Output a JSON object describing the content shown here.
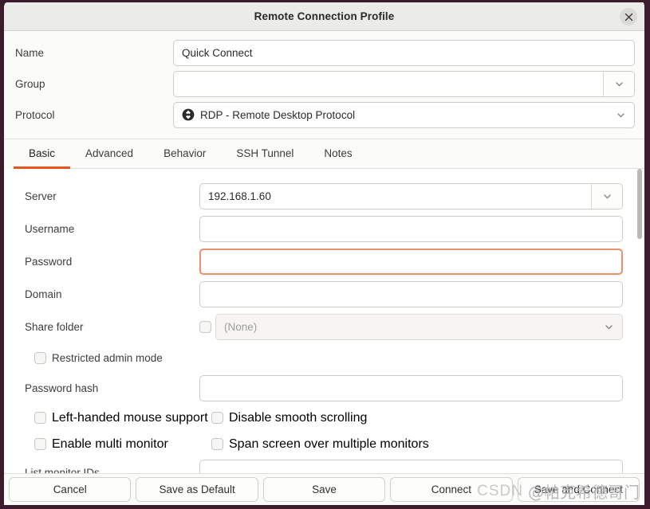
{
  "window": {
    "title": "Remote Connection Profile",
    "close_icon": "close-icon"
  },
  "top_form": {
    "name": {
      "label": "Name",
      "value": "Quick Connect",
      "placeholder": ""
    },
    "group": {
      "label": "Group",
      "value": "",
      "placeholder": ""
    },
    "protocol": {
      "label": "Protocol",
      "value": "RDP - Remote Desktop Protocol",
      "icon": "rdp-protocol-icon"
    }
  },
  "tabs": {
    "active": "Basic",
    "items": [
      {
        "label": "Basic"
      },
      {
        "label": "Advanced"
      },
      {
        "label": "Behavior"
      },
      {
        "label": "SSH Tunnel"
      },
      {
        "label": "Notes"
      }
    ]
  },
  "basic": {
    "server": {
      "label": "Server",
      "value": "192.168.1.60",
      "placeholder": ""
    },
    "username": {
      "label": "Username",
      "value": "",
      "placeholder": ""
    },
    "password": {
      "label": "Password",
      "value": "",
      "placeholder": "",
      "focused": true
    },
    "domain": {
      "label": "Domain",
      "value": "",
      "placeholder": ""
    },
    "share_folder": {
      "label": "Share folder",
      "value": "(None)",
      "checked": false,
      "enabled": false
    },
    "restricted_admin_mode": {
      "label": "Restricted admin mode",
      "checked": false
    },
    "password_hash": {
      "label": "Password hash",
      "value": "",
      "placeholder": ""
    },
    "left_handed_mouse": {
      "label": "Left-handed mouse support",
      "checked": false
    },
    "disable_smooth_scrolling": {
      "label": "Disable smooth scrolling",
      "checked": false
    },
    "enable_multi_monitor": {
      "label": "Enable multi monitor",
      "checked": false
    },
    "span_screen": {
      "label": "Span screen over multiple monitors",
      "checked": false
    },
    "list_monitor_ids": {
      "label": "List monitor IDs",
      "value": "",
      "placeholder": ""
    }
  },
  "footer": {
    "buttons": [
      {
        "label": "Cancel"
      },
      {
        "label": "Save as Default"
      },
      {
        "label": "Save"
      },
      {
        "label": "Connect"
      },
      {
        "label": "Save and Connect"
      }
    ]
  },
  "watermark": {
    "brand": "CSDN",
    "handle": "@帕克希德哥门"
  },
  "colors": {
    "accent": "#e95420",
    "focus_border": "#eb9068",
    "window_border": "#3d1b2c",
    "titlebar": "#ebebe9"
  }
}
